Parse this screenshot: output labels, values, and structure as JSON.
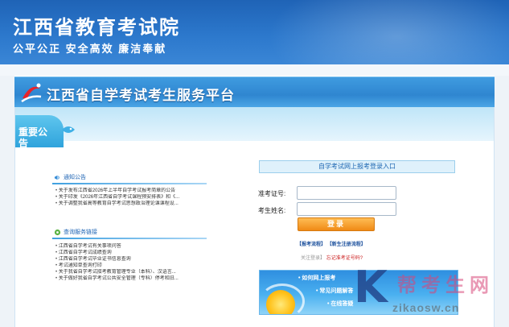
{
  "header": {
    "title": "江西省教育考试院",
    "slogan": "公平公正 安全高效 廉洁奉献"
  },
  "banner": {
    "title": "江西省自学考试考生服务平台"
  },
  "notice_tab": {
    "label": "重要公告"
  },
  "notices": {
    "heading": "通知公告",
    "items": [
      "关于发布江西省2026年上半年自学考试报考简章的公告",
      "关于印发《2026年江西省自学考试课程预安排表》和《...",
      "关于调整我省高等教育自学考试思想政治理论课课程设..."
    ]
  },
  "services": {
    "heading": "查询服务链接",
    "items": [
      "江西省自学考试有关事项问答",
      "江西省自学考试成绩查询",
      "江西省自学考试毕业证书信息查询",
      "考试通知单查询打印",
      "关于我省自学考试接考教育管理专业（本科）、汉语言...",
      "关于做好我省自学考试公共安全管理（专科）停考和旧..."
    ]
  },
  "login": {
    "title": "自学考试网上报考登录入口",
    "ticket_label": "准考证号:",
    "name_label": "考生姓名:",
    "button": "登录",
    "link_process": "【报考流程】",
    "link_register": "【新生注册流程】",
    "link_logout": "关注登录】",
    "link_forgot": "忘记准考证号码?"
  },
  "promo": {
    "line1": "• 如何网上报考",
    "line2": "• 常见问题解答",
    "line3": "• 在线答疑"
  },
  "watermark": {
    "brand": "帮考生网",
    "url": "zikaosw.cn",
    "k": "K"
  },
  "colors": {
    "header_blue": "#2c78cc",
    "banner_blue": "#2f86d0",
    "login_button": "#f08a16",
    "link_red": "#cc2222"
  }
}
